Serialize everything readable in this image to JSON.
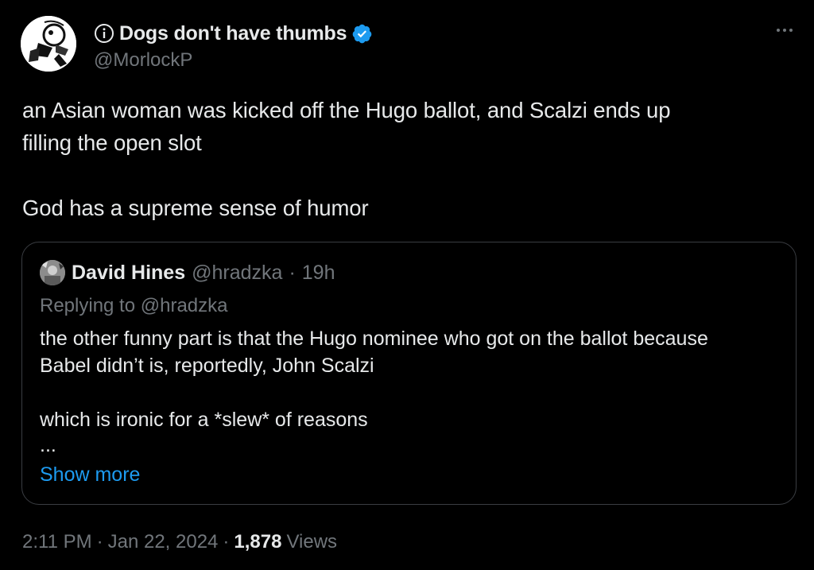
{
  "author": {
    "display_name": "Dogs don't have thumbs",
    "handle": "@MorlockP",
    "prefix_icon": "info-icon",
    "verified_icon": "verified-badge-icon",
    "verified_color": "#1d9bf0"
  },
  "tweet": {
    "lines": [
      "an Asian woman was kicked off the Hugo ballot, and Scalzi ends up",
      "filling the open slot",
      "God has a supreme sense of humor"
    ]
  },
  "quote": {
    "name": "David Hines",
    "handle": "@hradzka",
    "separator": "·",
    "time": "19h",
    "replying_to": "Replying to @hradzka",
    "text_lines": [
      "the other funny part is that the Hugo nominee who got on the ballot because",
      "Babel didn’t is, reportedly, John Scalzi",
      "which is ironic for a *slew* of reasons",
      "..."
    ],
    "show_more": "Show more"
  },
  "footer": {
    "time": "2:11 PM",
    "sep1": "·",
    "date": "Jan 22, 2024",
    "sep2": "·",
    "views_count": "1,878",
    "views_label": "Views"
  },
  "colors": {
    "background": "#000000",
    "text": "#e7e9ea",
    "secondary": "#71767b",
    "link": "#1d9bf0",
    "border": "#3a3d42"
  }
}
